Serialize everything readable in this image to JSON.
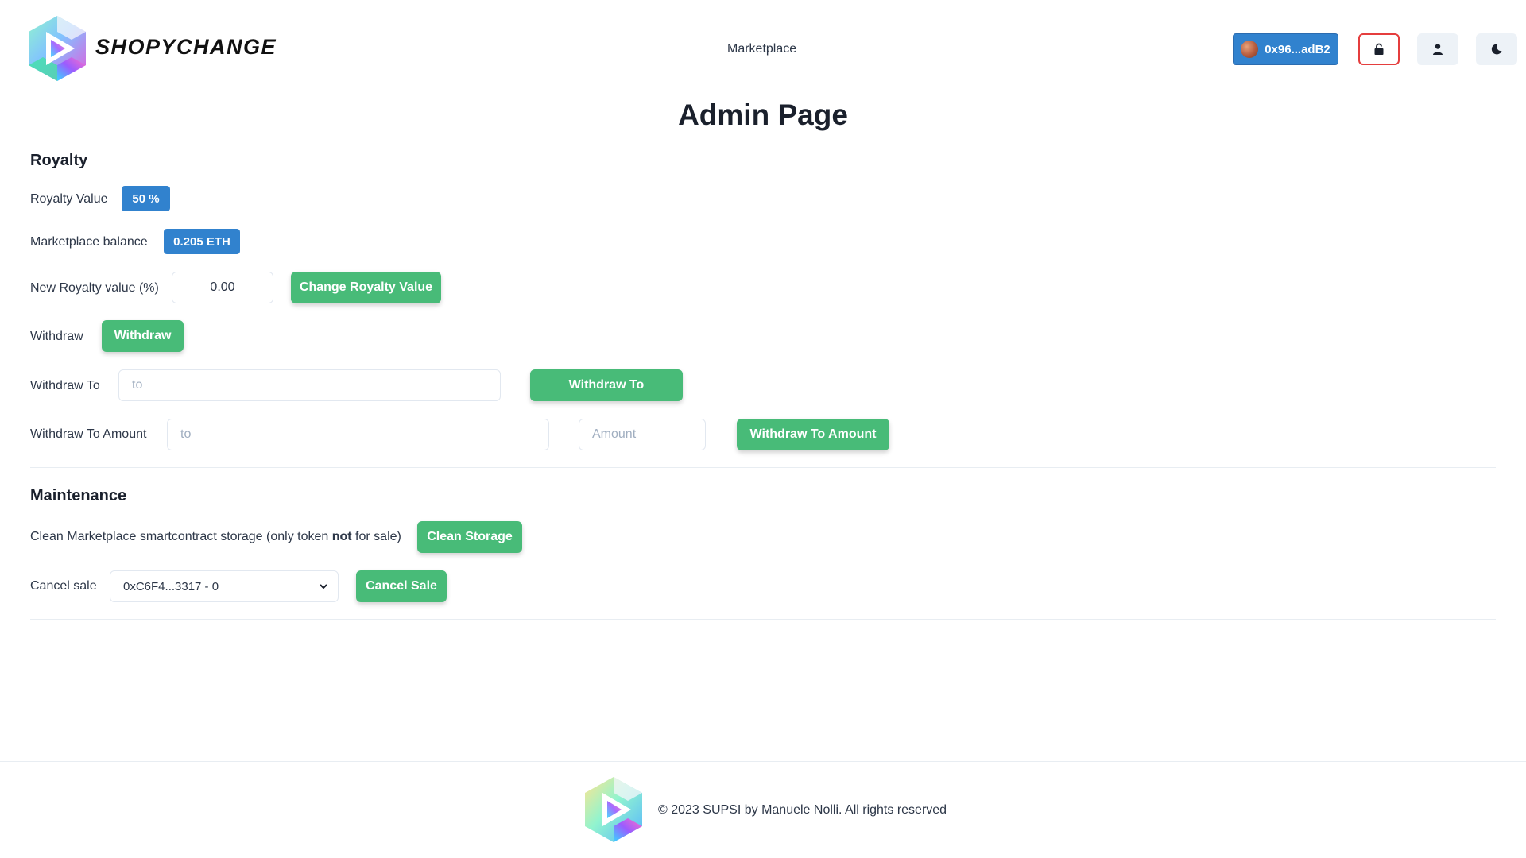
{
  "header": {
    "brand": "SHOPYCHANGE",
    "nav_marketplace": "Marketplace",
    "wallet_address": "0x96...adB2",
    "icons": {
      "lock": "unlock-icon",
      "user": "user-icon",
      "theme": "moon-icon"
    }
  },
  "page_title": "Admin Page",
  "royalty": {
    "title": "Royalty",
    "royalty_value_label": "Royalty Value",
    "royalty_value": "50 %",
    "balance_label": "Marketplace balance",
    "balance_value": "0.205 ETH",
    "new_royalty_label": "New Royalty value (%)",
    "new_royalty_input": "0.00",
    "change_button": "Change Royalty Value",
    "withdraw_label": "Withdraw",
    "withdraw_button": "Withdraw",
    "withdraw_to_label": "Withdraw To",
    "withdraw_to_placeholder": "to",
    "withdraw_to_button": "Withdraw To",
    "withdraw_to_amount_label": "Withdraw To Amount",
    "withdraw_to_amount_placeholder_to": "to",
    "withdraw_to_amount_placeholder_amount": "Amount",
    "withdraw_to_amount_button": "Withdraw To Amount"
  },
  "maintenance": {
    "title": "Maintenance",
    "clean_label_before": "Clean Marketplace smartcontract storage (only token ",
    "clean_label_bold": "not",
    "clean_label_after": " for sale)",
    "clean_button": "Clean Storage",
    "cancel_label": "Cancel sale",
    "cancel_select_value": "0xC6F4...3317 - 0",
    "cancel_button": "Cancel Sale"
  },
  "footer": {
    "text": "© 2023 SUPSI by Manuele Nolli. All rights reserved"
  },
  "colors": {
    "primary_blue": "#3182ce",
    "success_green": "#48bb78",
    "danger_red": "#e53e3e"
  }
}
